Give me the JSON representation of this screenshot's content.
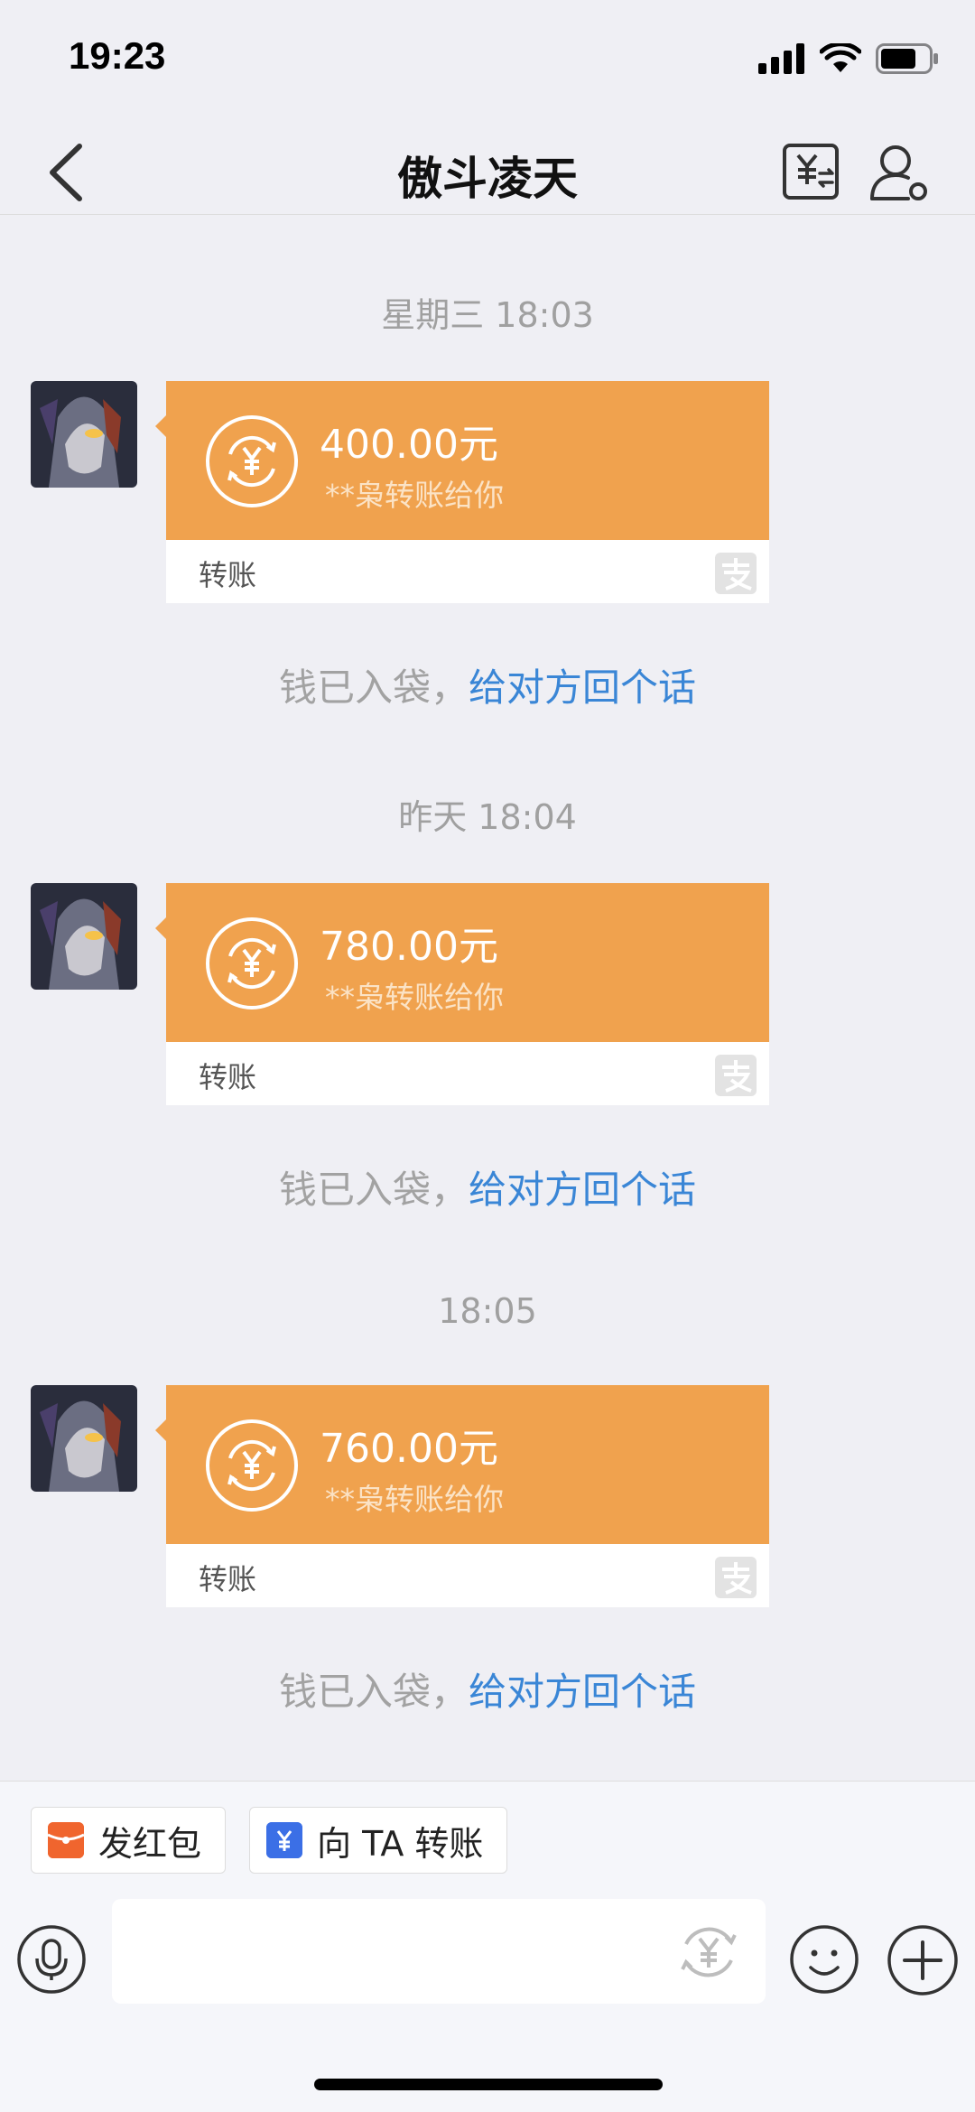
{
  "status_bar": {
    "time": "19:23"
  },
  "header": {
    "title": "傲斗凌天"
  },
  "messages": [
    {
      "timestamp": "星期三 18:03",
      "amount": "400.00元",
      "subtitle": "**枭转账给你",
      "label": "转账",
      "notice_prefix": "钱已入袋，",
      "notice_link": "给对方回个话"
    },
    {
      "timestamp": "昨天 18:04",
      "amount": "780.00元",
      "subtitle": "**枭转账给你",
      "label": "转账",
      "notice_prefix": "钱已入袋，",
      "notice_link": "给对方回个话"
    },
    {
      "timestamp": "18:05",
      "amount": "760.00元",
      "subtitle": "**枭转账给你",
      "label": "转账",
      "notice_prefix": "钱已入袋，",
      "notice_link": "给对方回个话"
    }
  ],
  "quick_actions": {
    "red_packet": "发红包",
    "transfer": "向 TA 转账"
  },
  "input": {
    "placeholder": ""
  },
  "colors": {
    "card": "#f0a24e",
    "link": "#3a86d6",
    "red_packet": "#f0652e",
    "transfer": "#3b6fe6"
  }
}
